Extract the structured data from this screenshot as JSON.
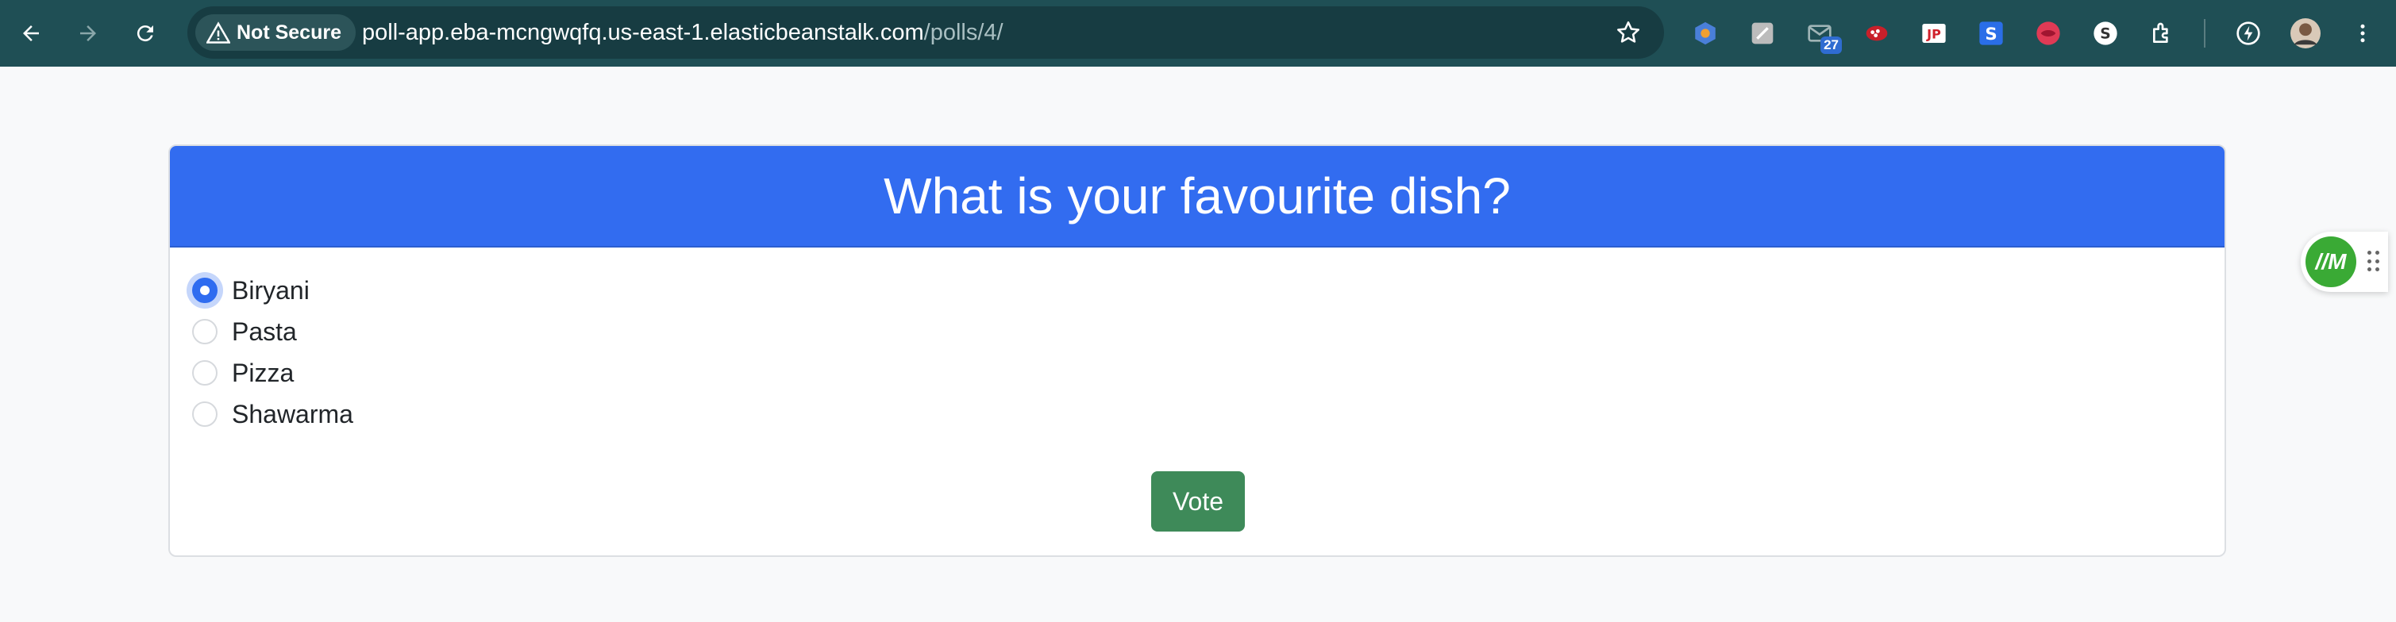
{
  "browser": {
    "security_label": "Not Secure",
    "url_host": "poll-app.eba-mcngwqfq.us-east-1.elasticbeanstalk.com",
    "url_path": "/polls/4/",
    "mail_badge_count": "27",
    "extension_icons": [
      "hexagon-icon",
      "note-icon",
      "mail-icon",
      "dots-icon",
      "jf-icon",
      "s-icon",
      "lips-icon",
      "s-circle-icon",
      "puzzle-icon",
      "lightning-icon",
      "avatar"
    ]
  },
  "poll": {
    "question": "What is your favourite dish?",
    "choices": [
      {
        "label": "Biryani",
        "selected": true
      },
      {
        "label": "Pasta",
        "selected": false
      },
      {
        "label": "Pizza",
        "selected": false
      },
      {
        "label": "Shawarma",
        "selected": false
      }
    ],
    "vote_label": "Vote"
  },
  "widget": {
    "logo_text": "//M"
  },
  "colors": {
    "toolbar": "#1f4f55",
    "header": "#326cf0",
    "vote_button": "#3e8a59",
    "page_background": "#f8f9fa"
  }
}
